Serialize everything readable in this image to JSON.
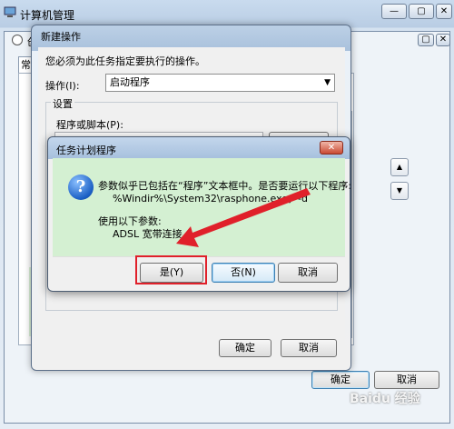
{
  "main_window": {
    "title": "计算机管理",
    "controls": [
      "—",
      "▢",
      "✕"
    ]
  },
  "task_window": {
    "title_fragment": "创",
    "tab_fragment": "常",
    "ok_label": "确定",
    "cancel_label": "取消"
  },
  "new_action_dialog": {
    "title": "新建操作",
    "prompt": "您必须为此任务指定要执行的操作。",
    "action_label": "操作(I):",
    "action_value": "启动程序",
    "settings_label": "设置",
    "program_label": "程序或脚本(P):",
    "ok_label": "确定",
    "cancel_label": "取消"
  },
  "message_dialog": {
    "title": "任务计划程序",
    "line1": "参数似乎已包括在“程序”文本框中。是否要运行以下程序:",
    "line2": "%Windir%\\System32\\rasphone.exe，-d",
    "line3": "使用以下参数:",
    "line4": "ADSL 宽带连接",
    "yes_label": "是(Y)",
    "no_label": "否(N)",
    "cancel_label": "取消"
  },
  "icons": {
    "question": "?",
    "close": "✕",
    "scroll_up": "▲",
    "scroll_down": "▼",
    "dropdown": "▼"
  },
  "watermark": "Baidu 经验",
  "colors": {
    "highlight_red": "#e0202a",
    "content_green": "#d4f0d2"
  }
}
